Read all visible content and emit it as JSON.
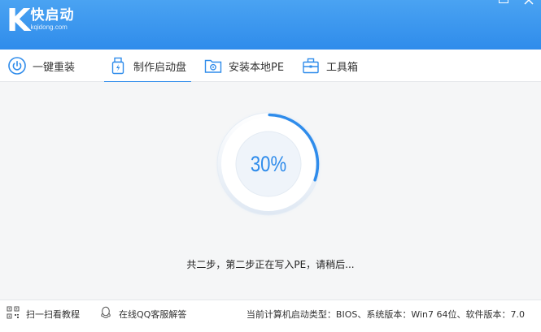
{
  "app": {
    "name": "快启动",
    "domain": "kqidong.com"
  },
  "tabs": [
    {
      "label": "一键重装",
      "icon": "power-icon",
      "active": false
    },
    {
      "label": "制作启动盘",
      "icon": "usb-drive-icon",
      "active": true
    },
    {
      "label": "安装本地PE",
      "icon": "folder-gear-icon",
      "active": false
    },
    {
      "label": "工具箱",
      "icon": "toolbox-icon",
      "active": false
    }
  ],
  "progress": {
    "percent": 30,
    "label": "30%",
    "status": "共二步，第二步正在写入PE，请稍后..."
  },
  "footer": {
    "scan_tutorial": "扫一扫看教程",
    "qq_support": "在线QQ客服解答",
    "info": "当前计算机启动类型：BIOS、系统版本：Win7 64位、软件版本：7.0"
  },
  "colors": {
    "accent": "#2f8ceb",
    "titlebar": "#3d98ee"
  }
}
